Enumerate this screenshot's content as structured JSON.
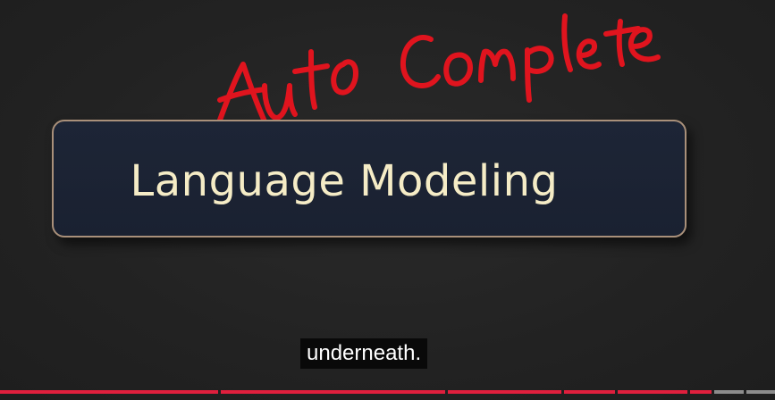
{
  "annotation": {
    "text": "Auto Complete",
    "color": "#e0141e"
  },
  "title_card": {
    "title": "Language Modeling",
    "text_color": "#f5ecc6",
    "background": "#1c2333",
    "border_color": "#a9907a"
  },
  "caption": {
    "text": "underneath."
  },
  "player": {
    "progress_color": "#e01f3d",
    "buffer_color": "#8c8c8c"
  }
}
